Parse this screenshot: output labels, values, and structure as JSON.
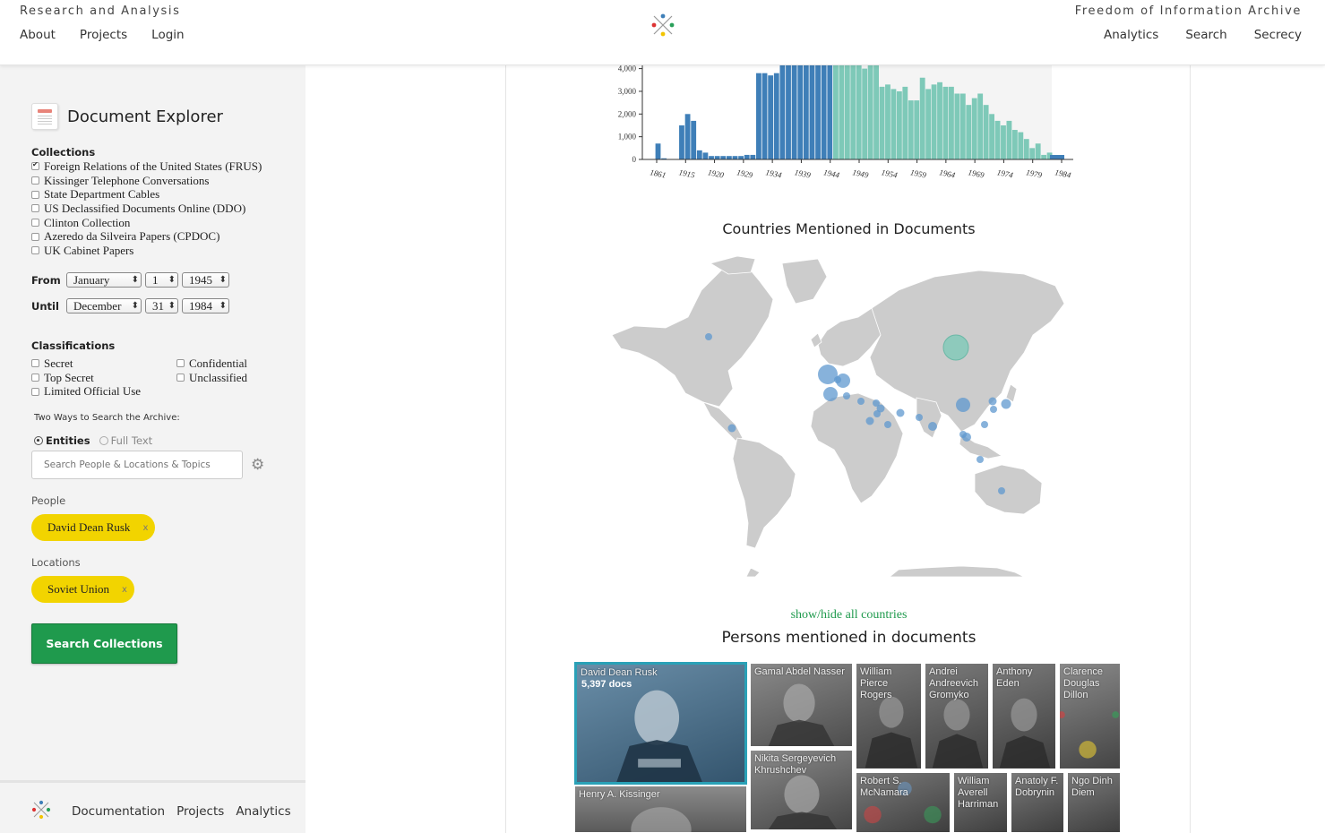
{
  "header": {
    "brand_left": "Research and Analysis",
    "brand_right": "Freedom of Information Archive",
    "nav_left": [
      "About",
      "Projects",
      "Login"
    ],
    "nav_right": [
      "Analytics",
      "Search",
      "Secrecy"
    ],
    "logo_icon": "history-lab-logo-icon"
  },
  "sidebar": {
    "title": "Document Explorer",
    "collections_label": "Collections",
    "collections": [
      {
        "label": "Foreign Relations of the United States (FRUS)",
        "checked": true
      },
      {
        "label": "Kissinger Telephone Conversations",
        "checked": false
      },
      {
        "label": "State Department Cables",
        "checked": false
      },
      {
        "label": "US Declassified Documents Online (DDO)",
        "checked": false
      },
      {
        "label": "Clinton Collection",
        "checked": false
      },
      {
        "label": "Azeredo da Silveira Papers (CPDOC)",
        "checked": false
      },
      {
        "label": "UK Cabinet Papers",
        "checked": false
      }
    ],
    "from": {
      "label": "From",
      "month": "January",
      "day": "1",
      "year": "1945"
    },
    "until": {
      "label": "Until",
      "month": "December",
      "day": "31",
      "year": "1984"
    },
    "classifications_label": "Classifications",
    "classifications": [
      "Secret",
      "Confidential",
      "Top Secret",
      "Unclassified",
      "Limited Official Use"
    ],
    "ways_label": "Two Ways to Search the Archive:",
    "mode_entities": "Entities",
    "mode_fulltext": "Full Text",
    "search_placeholder": "Search People & Locations & Topics",
    "people_label": "People",
    "people_chip": "David Dean Rusk",
    "locations_label": "Locations",
    "locations_chip": "Soviet Union",
    "chip_remove": "x",
    "search_button": "Search Collections",
    "footer_links": [
      "Documentation",
      "Projects",
      "Analytics"
    ]
  },
  "main": {
    "countries_title": "Countries Mentioned in Documents",
    "show_hide": "show/hide all countries",
    "persons_title": "Persons mentioned in documents",
    "persons": [
      {
        "name": "David Dean Rusk",
        "count": "5,397 docs"
      },
      {
        "name": "Gamal Abdel Nasser"
      },
      {
        "name": "William Pierce Rogers"
      },
      {
        "name": "Andrei Andreevich Gromyko"
      },
      {
        "name": "Anthony Eden"
      },
      {
        "name": "Clarence Douglas Dillon"
      },
      {
        "name": "Nikita Sergeyevich Khrushchev"
      },
      {
        "name": "Robert S. McNamara"
      },
      {
        "name": "William Averell Harriman"
      },
      {
        "name": "Anatoly F. Dobrynin"
      },
      {
        "name": "Ngo Dinh Diem"
      },
      {
        "name": "Henry A. Kissinger"
      }
    ]
  },
  "colors": {
    "accent_green": "#1f9a4d",
    "chip_yellow": "#f2d400",
    "bar_blue": "#3f7fb8",
    "bar_teal": "#7ec9b8",
    "bubble_blue": "#6b9ed0",
    "land_gray": "#cccccc"
  },
  "chart_data": {
    "type": "bar",
    "x_ticks": [
      "1861",
      "1915",
      "1920",
      "1929",
      "1934",
      "1939",
      "1944",
      "1949",
      "1954",
      "1959",
      "1964",
      "1969",
      "1974",
      "1979",
      "1984"
    ],
    "y_ticks": [
      "0",
      "1,000",
      "2,000",
      "3,000",
      "4,000"
    ],
    "ylim": [
      0,
      4300
    ],
    "selected_range": [
      1945,
      1984
    ],
    "series": [
      {
        "values_pre": [
          0,
          700,
          50,
          0,
          0,
          1500,
          2000,
          1700,
          400,
          300,
          150,
          150,
          150,
          150,
          150,
          150,
          200,
          200,
          3800,
          3800,
          3700,
          3800,
          4300,
          4300,
          4300,
          4300,
          4300,
          4300,
          4300,
          4300,
          4300
        ]
      },
      {
        "values_post": [
          4300,
          4300,
          4300,
          4300,
          4300,
          4000,
          4300,
          4300,
          3200,
          3300,
          3100,
          3000,
          3200,
          2600,
          2600,
          3600,
          3100,
          3300,
          3400,
          3200,
          3200,
          2900,
          2900,
          2400,
          2700,
          2900,
          2400,
          2000,
          1700,
          1500,
          1700,
          1300,
          1200,
          900,
          500,
          700,
          200,
          300,
          0,
          0
        ]
      }
    ]
  }
}
